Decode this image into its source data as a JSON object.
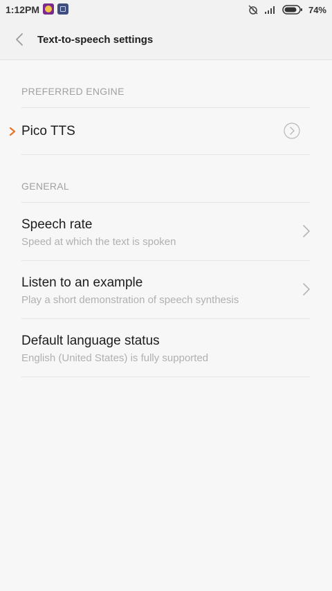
{
  "status_bar": {
    "time": "1:12PM",
    "battery_percent": "74%"
  },
  "toolbar": {
    "title": "Text-to-speech settings"
  },
  "sections": {
    "preferred_engine": {
      "header": "PREFERRED ENGINE",
      "engine_name": "Pico TTS"
    },
    "general": {
      "header": "GENERAL",
      "items": [
        {
          "title": "Speech rate",
          "subtitle": "Speed at which the text is spoken"
        },
        {
          "title": "Listen to an example",
          "subtitle": "Play a short demonstration of speech synthesis"
        },
        {
          "title": "Default language status",
          "subtitle": "English (United States) is fully supported"
        }
      ]
    }
  },
  "colors": {
    "accent": "#e8722a",
    "background": "#f7f7f7",
    "toolbar": "#f2f2f2",
    "section_header": "#a0a0a0",
    "subtitle": "#b0b0b0"
  }
}
